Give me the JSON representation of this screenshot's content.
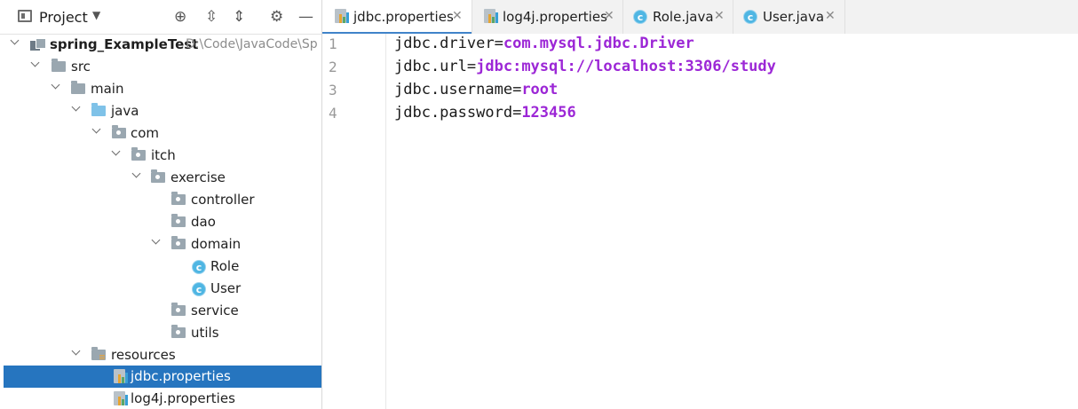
{
  "project_panel": {
    "title": "Project",
    "toolbar_icons": [
      "crosshair-icon",
      "expand-all-icon",
      "collapse-all-icon",
      "gear-icon",
      "minimize-icon"
    ]
  },
  "tree": {
    "root": {
      "name": "spring_ExampleTest",
      "path": "D:\\Code\\JavaCode\\Sp"
    },
    "src": "src",
    "main": "main",
    "java": "java",
    "com": "com",
    "itch": "itch",
    "exercise": "exercise",
    "controller": "controller",
    "dao": "dao",
    "domain": "domain",
    "role": "Role",
    "user": "User",
    "service": "service",
    "utils": "utils",
    "resources": "resources",
    "jdbc_properties": "jdbc.properties",
    "log4j_properties": "log4j.properties"
  },
  "tabs": [
    {
      "label": "jdbc.properties",
      "icon": "properties-file-icon",
      "active": true
    },
    {
      "label": "log4j.properties",
      "icon": "properties-file-icon",
      "active": false
    },
    {
      "label": "Role.java",
      "icon": "java-class-icon",
      "active": false
    },
    {
      "label": "User.java",
      "icon": "java-class-icon",
      "active": false
    }
  ],
  "editor": {
    "current_line": 4,
    "lines": [
      {
        "num": "1",
        "key": "jdbc.driver",
        "eq": "=",
        "value": "com.mysql.jdbc.Driver"
      },
      {
        "num": "2",
        "key": "jdbc.url",
        "eq": "=",
        "value": "jdbc:mysql://localhost:3306/study"
      },
      {
        "num": "3",
        "key": "jdbc.username",
        "eq": "=",
        "value": "root"
      },
      {
        "num": "4",
        "key": "jdbc.password",
        "eq": "=",
        "value": "123456"
      }
    ]
  },
  "colors": {
    "selection": "#2675bf",
    "value_text": "#9c27d6",
    "current_line_bg": "#fdf9e4",
    "tab_underline": "#4083c9"
  }
}
